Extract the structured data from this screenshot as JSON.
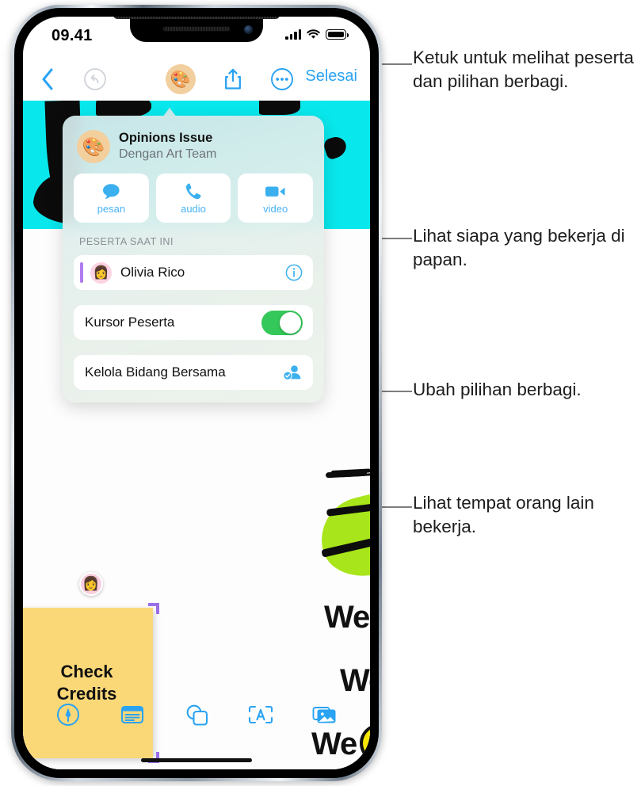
{
  "device": {
    "status_bar": {
      "time": "09.41",
      "signal_icon": "cellular-bars-icon",
      "wifi_icon": "wifi-icon",
      "battery_icon": "battery-full-icon"
    },
    "home_indicator": "home-indicator"
  },
  "app_topbar": {
    "back_icon": "chevron-left-icon",
    "undo_icon": "undo-arrow-icon",
    "collab_avatar_icon": "artist-palette-avatar",
    "share_icon": "share-up-arrow-icon",
    "more_icon": "ellipsis-circle-icon",
    "done_label": "Selesai"
  },
  "popover": {
    "title": "Opinions Issue",
    "subtitle": "Dengan Art Team",
    "avatar_icon": "artist-palette-avatar",
    "actions": [
      {
        "label": "pesan",
        "icon": "message-bubble-icon"
      },
      {
        "label": "audio",
        "icon": "phone-handset-icon"
      },
      {
        "label": "video",
        "icon": "video-camera-icon"
      }
    ],
    "section_label": "PESERTA SAAT INI",
    "participant": {
      "name": "Olivia Rico",
      "avatar_icon": "memoji-avatar",
      "info_icon": "info-circle-icon",
      "cursor_color": "#b07cf0"
    },
    "cursor_setting": {
      "label": "Kursor Peserta",
      "toggle_state": "on",
      "toggle_color": "#34c759"
    },
    "manage_row": {
      "label": "Kelola Bidang Bersama",
      "icon": "person-badge-check-icon"
    }
  },
  "canvas": {
    "cyan_band_color": "#08e8ec",
    "green_highlight_color": "#a8e51b",
    "yellow_highlight_color": "#f7e700",
    "sticky_note": {
      "text": "Check\nCredits",
      "line1": "Check",
      "line2": "Credits",
      "color": "#fad878",
      "selection_handle_color": "#9a6ee8"
    },
    "cursor_avatar_icon": "memoji-avatar",
    "text_objects": [
      "We",
      "We",
      "We"
    ]
  },
  "bottom_toolbar": {
    "tools": [
      {
        "name": "markup-pen-tool",
        "icon": "pen-in-circle-icon"
      },
      {
        "name": "sticky-note-tool",
        "icon": "note-lines-icon"
      },
      {
        "name": "shapes-tool",
        "icon": "overlapping-shapes-icon"
      },
      {
        "name": "text-box-tool",
        "icon": "text-a-box-icon"
      },
      {
        "name": "media-tool",
        "icon": "photo-stack-icon"
      }
    ]
  },
  "callouts": [
    {
      "id": 1,
      "text": "Ketuk untuk melihat peserta dan pilihan berbagi."
    },
    {
      "id": 2,
      "text": "Lihat siapa yang bekerja di papan."
    },
    {
      "id": 3,
      "text": "Ubah pilihan berbagi."
    },
    {
      "id": 4,
      "text": "Lihat tempat orang lain bekerja."
    }
  ]
}
